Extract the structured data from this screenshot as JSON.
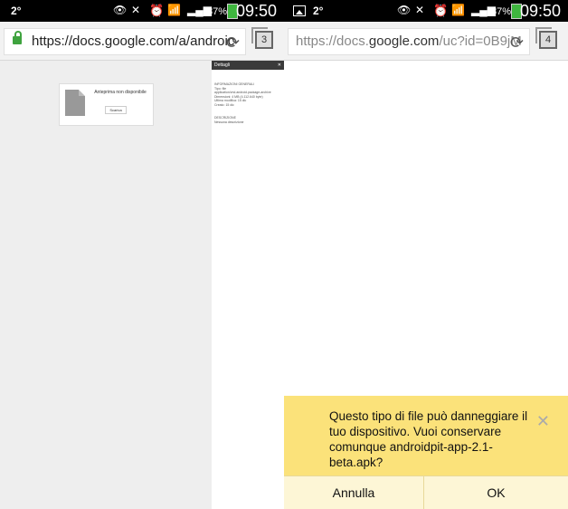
{
  "left_screen": {
    "status_bar": {
      "temp": "2°",
      "battery_pct": "87%",
      "time": "09:50"
    },
    "toolbar": {
      "url": "https://docs.google.com/a/androic",
      "tab_count": "3"
    },
    "preview": {
      "message": "Anteprima non disponibile",
      "button_label": "Scarica"
    },
    "details_panel": {
      "title": "Dettagli",
      "section_general": "INFORMAZIONI GENERALI",
      "type_label": "Tipo: file",
      "type_value": "application/vnd.android.package-archive",
      "size": "Dimensioni: 4 MB (4.112.640 byte)",
      "modified": "Ultima modifica: 15 dic",
      "created": "Creato: 15 dic",
      "section_description": "DESCRIZIONE",
      "description_placeholder": "Nessuna descrizione"
    }
  },
  "right_screen": {
    "status_bar": {
      "temp": "2°",
      "battery_pct": "87%",
      "time": "09:50"
    },
    "toolbar": {
      "url_prefix": "https://docs.",
      "url_domain": "google.com",
      "url_suffix": "/uc?id=0B9jM",
      "tab_count": "4"
    },
    "dialog": {
      "message": "Questo tipo di file può danneggiare il tuo dispositivo. Vuoi conservare comunque androidpit-app-2.1-beta.apk?",
      "cancel_label": "Annulla",
      "ok_label": "OK"
    }
  }
}
